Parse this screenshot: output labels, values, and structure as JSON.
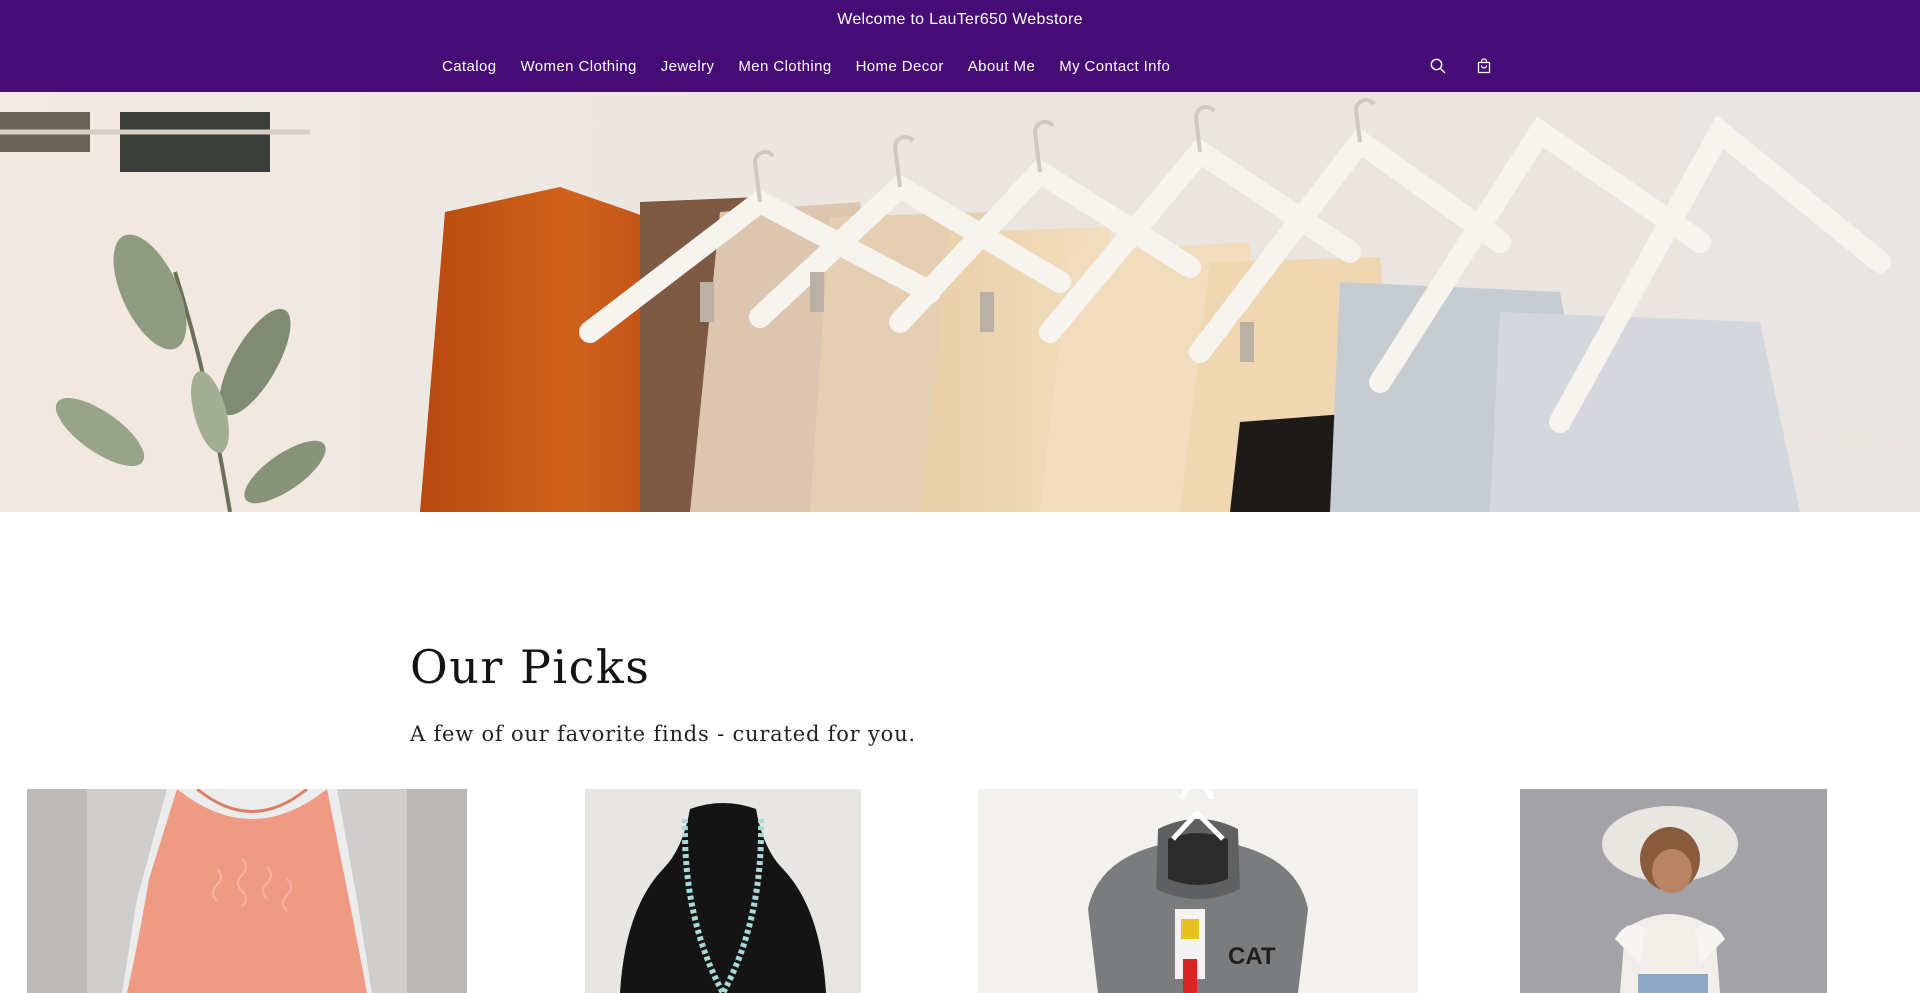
{
  "announcement": {
    "text": "Welcome to LauTer650 Webstore"
  },
  "nav": {
    "links": [
      {
        "label": "Catalog"
      },
      {
        "label": "Women Clothing"
      },
      {
        "label": "Jewelry"
      },
      {
        "label": "Men Clothing"
      },
      {
        "label": "Home Decor"
      },
      {
        "label": "About Me"
      },
      {
        "label": "My Contact Info"
      }
    ],
    "icons": [
      "search-icon",
      "cart-icon"
    ]
  },
  "theme": {
    "header_bg": "#460c75",
    "header_text": "#ffffff",
    "page_bg": "#ffffff"
  },
  "picks": {
    "title": "Our Picks",
    "subtitle": "A few of our favorite finds - curated for you.",
    "products": [
      {
        "image": "coral-sleeveless-top"
      },
      {
        "image": "turquoise-bead-necklace"
      },
      {
        "image": "gray-cat-hoodie",
        "logo_text": "CAT"
      },
      {
        "image": "porcelain-girl-figurine"
      }
    ]
  }
}
